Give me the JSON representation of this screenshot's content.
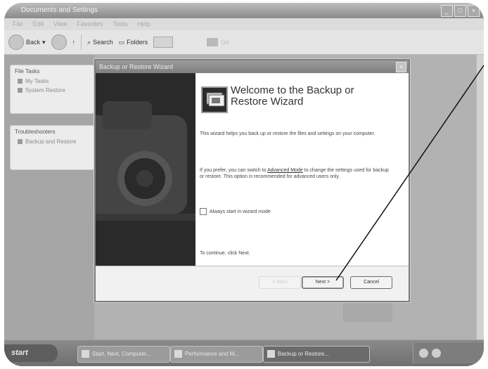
{
  "window": {
    "title": "Documents and Settings",
    "controls": [
      "_",
      "□",
      "×"
    ]
  },
  "menu": [
    "File",
    "Edit",
    "View",
    "Favorites",
    "Tools",
    "Help"
  ],
  "toolbar": {
    "back_label": "Back",
    "search_label": "Search",
    "folders_label": "Folders",
    "go_label": "Go"
  },
  "sidebar": {
    "file_tasks": {
      "heading": "File Tasks",
      "items": [
        "My Tasks",
        "System Restore"
      ]
    },
    "troubleshooters": {
      "heading": "Troubleshooters",
      "items": [
        "Backup and Restore"
      ]
    }
  },
  "wizard": {
    "title": "Backup or Restore Wizard",
    "close_label": "×",
    "heading": "Welcome to the Backup or Restore Wizard",
    "intro": "This wizard helps you back up or restore the files and settings on your computer.",
    "advanced_pre": "If you prefer, you can switch to ",
    "advanced_link": "Advanced Mode",
    "advanced_post": " to change the settings used for backup or restore. This option is recommended for advanced users only.",
    "checkbox_label": "Always start in wizard mode",
    "continue_text": "To continue, click Next.",
    "back_button": "< Back",
    "next_button": "Next >",
    "cancel_button": "Cancel"
  },
  "taskbar": {
    "start_label": "start",
    "tasks": [
      "Start, Next, Computer...",
      "Performance and M...",
      "Backup or Restore..."
    ]
  },
  "colors": {
    "desktop": "#8d8d8d",
    "dialog_side_panel": "#2a2a2a",
    "taskbar": "#7a7a7a"
  }
}
